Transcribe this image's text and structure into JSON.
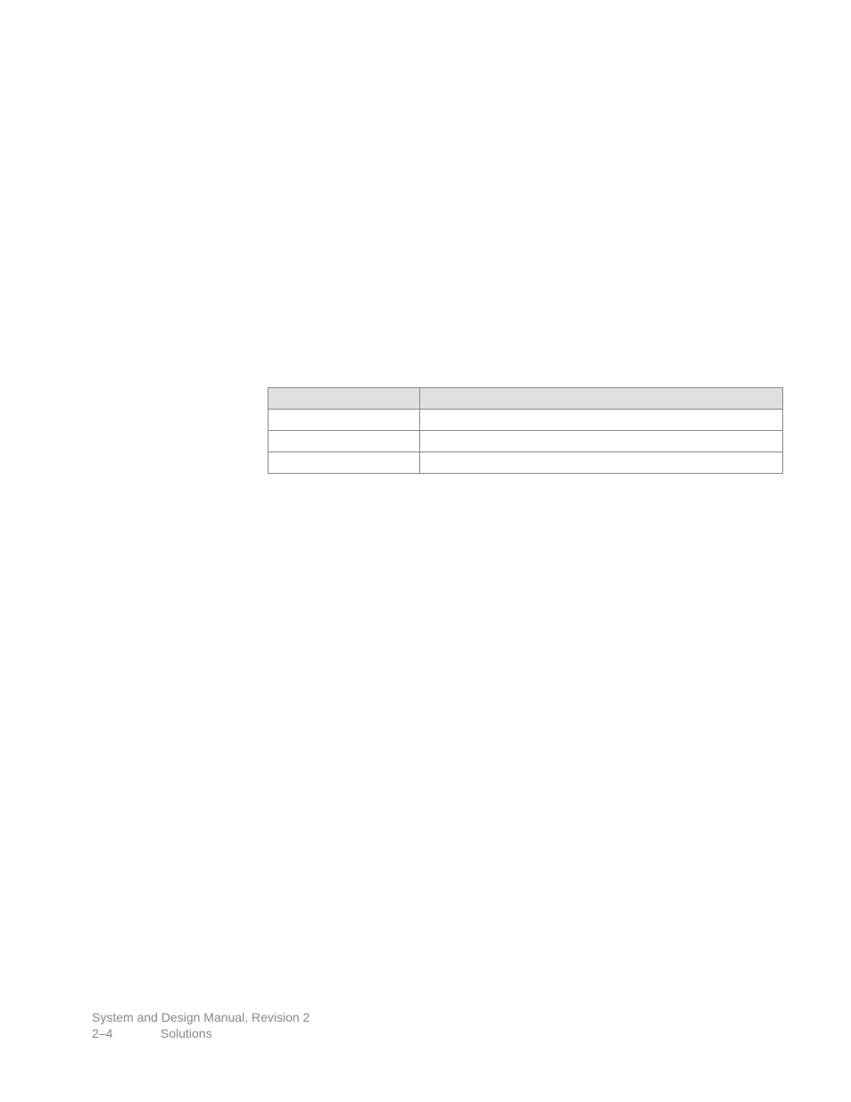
{
  "footer": {
    "line1": "System and Design Manual, Revision 2",
    "page_num": "2–4",
    "section": "Solutions"
  }
}
